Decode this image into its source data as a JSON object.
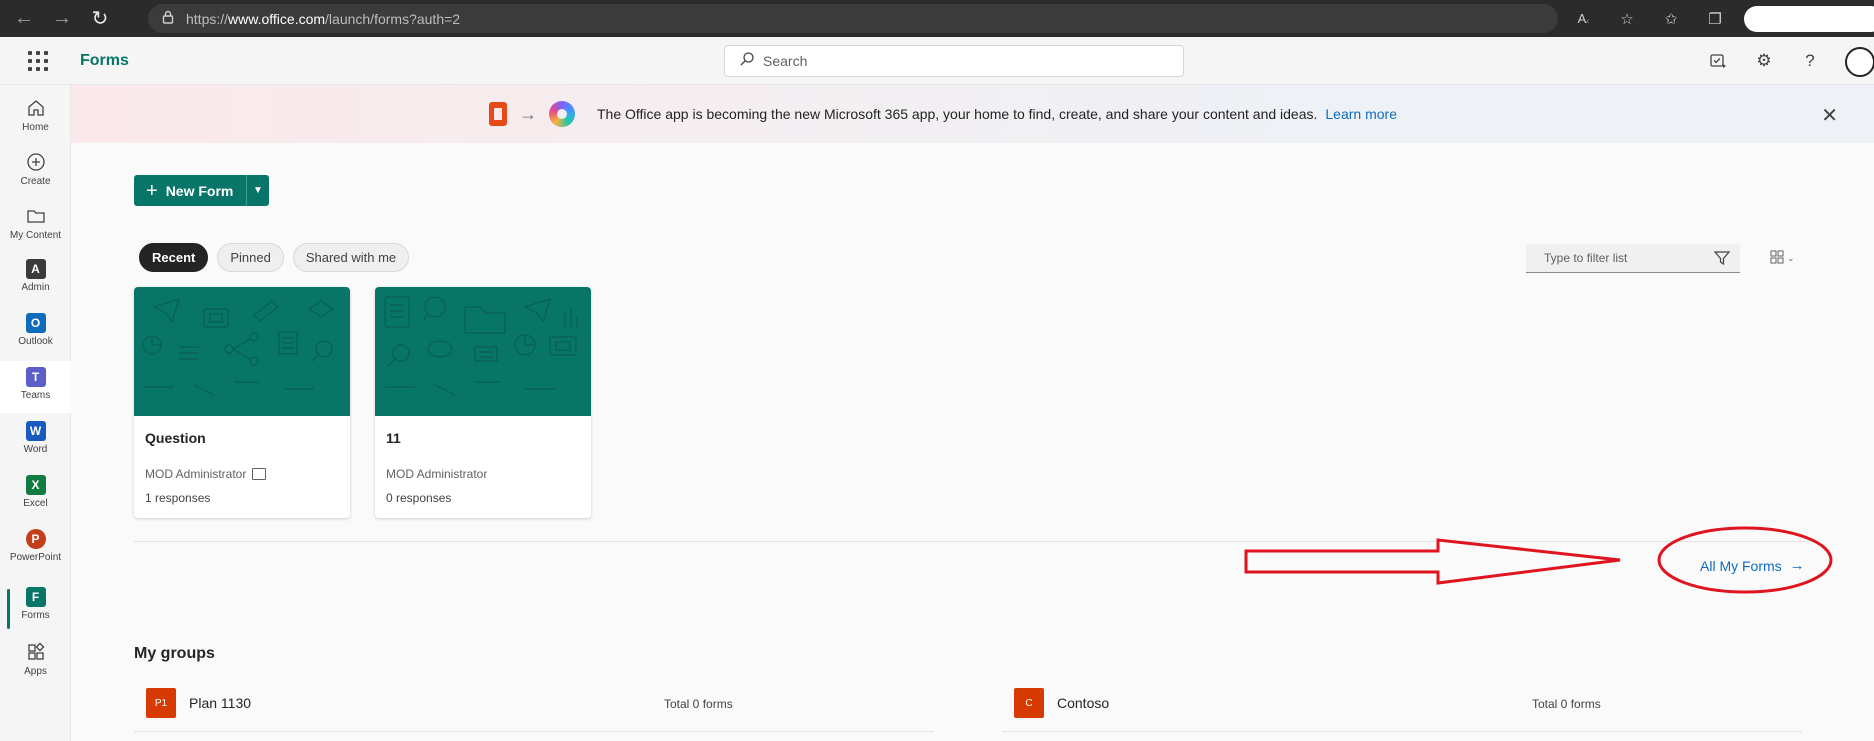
{
  "browser": {
    "url_prefix": "https://",
    "url_host": "www.office.com",
    "url_path": "/launch/forms?auth=2",
    "back_icon": "arrow-left-icon",
    "forward_icon": "arrow-right-icon",
    "refresh_icon": "refresh-icon",
    "read_aloud_label": "Aᴬ"
  },
  "header": {
    "app_name": "Forms",
    "search_placeholder": "Search"
  },
  "rail": {
    "items": [
      {
        "label": "Home"
      },
      {
        "label": "Create"
      },
      {
        "label": "My Content"
      },
      {
        "label": "Admin",
        "tile": "A"
      },
      {
        "label": "Outlook",
        "tile": "O"
      },
      {
        "label": "Teams",
        "tile": "T"
      },
      {
        "label": "Word",
        "tile": "W"
      },
      {
        "label": "Excel",
        "tile": "X"
      },
      {
        "label": "PowerPoint",
        "tile": "P"
      },
      {
        "label": "Forms",
        "tile": "F"
      },
      {
        "label": "Apps"
      }
    ]
  },
  "banner": {
    "text": "The Office app is becoming the new Microsoft 365 app, your home to find, create, and share your content and ideas.",
    "link": "Learn more"
  },
  "main": {
    "new_form_label": "New Form",
    "tabs": [
      {
        "label": "Recent"
      },
      {
        "label": "Pinned"
      },
      {
        "label": "Shared with me"
      }
    ],
    "filter_placeholder": "Type to filter list",
    "cards": [
      {
        "title": "Question",
        "owner": "MOD Administrator",
        "responses": "1 responses"
      },
      {
        "title": "11",
        "owner": "MOD Administrator",
        "responses": "0 responses"
      }
    ],
    "all_forms_label": "All My Forms"
  },
  "groups": {
    "title": "My groups",
    "items": [
      {
        "badge": "P1",
        "name": "Plan 1130",
        "total": "Total 0 forms"
      },
      {
        "badge": "C",
        "name": "Contoso",
        "total": "Total 0 forms"
      }
    ]
  },
  "colors": {
    "brand": "#077568",
    "link": "#0f6cbd",
    "annotation": "#e0141e"
  }
}
